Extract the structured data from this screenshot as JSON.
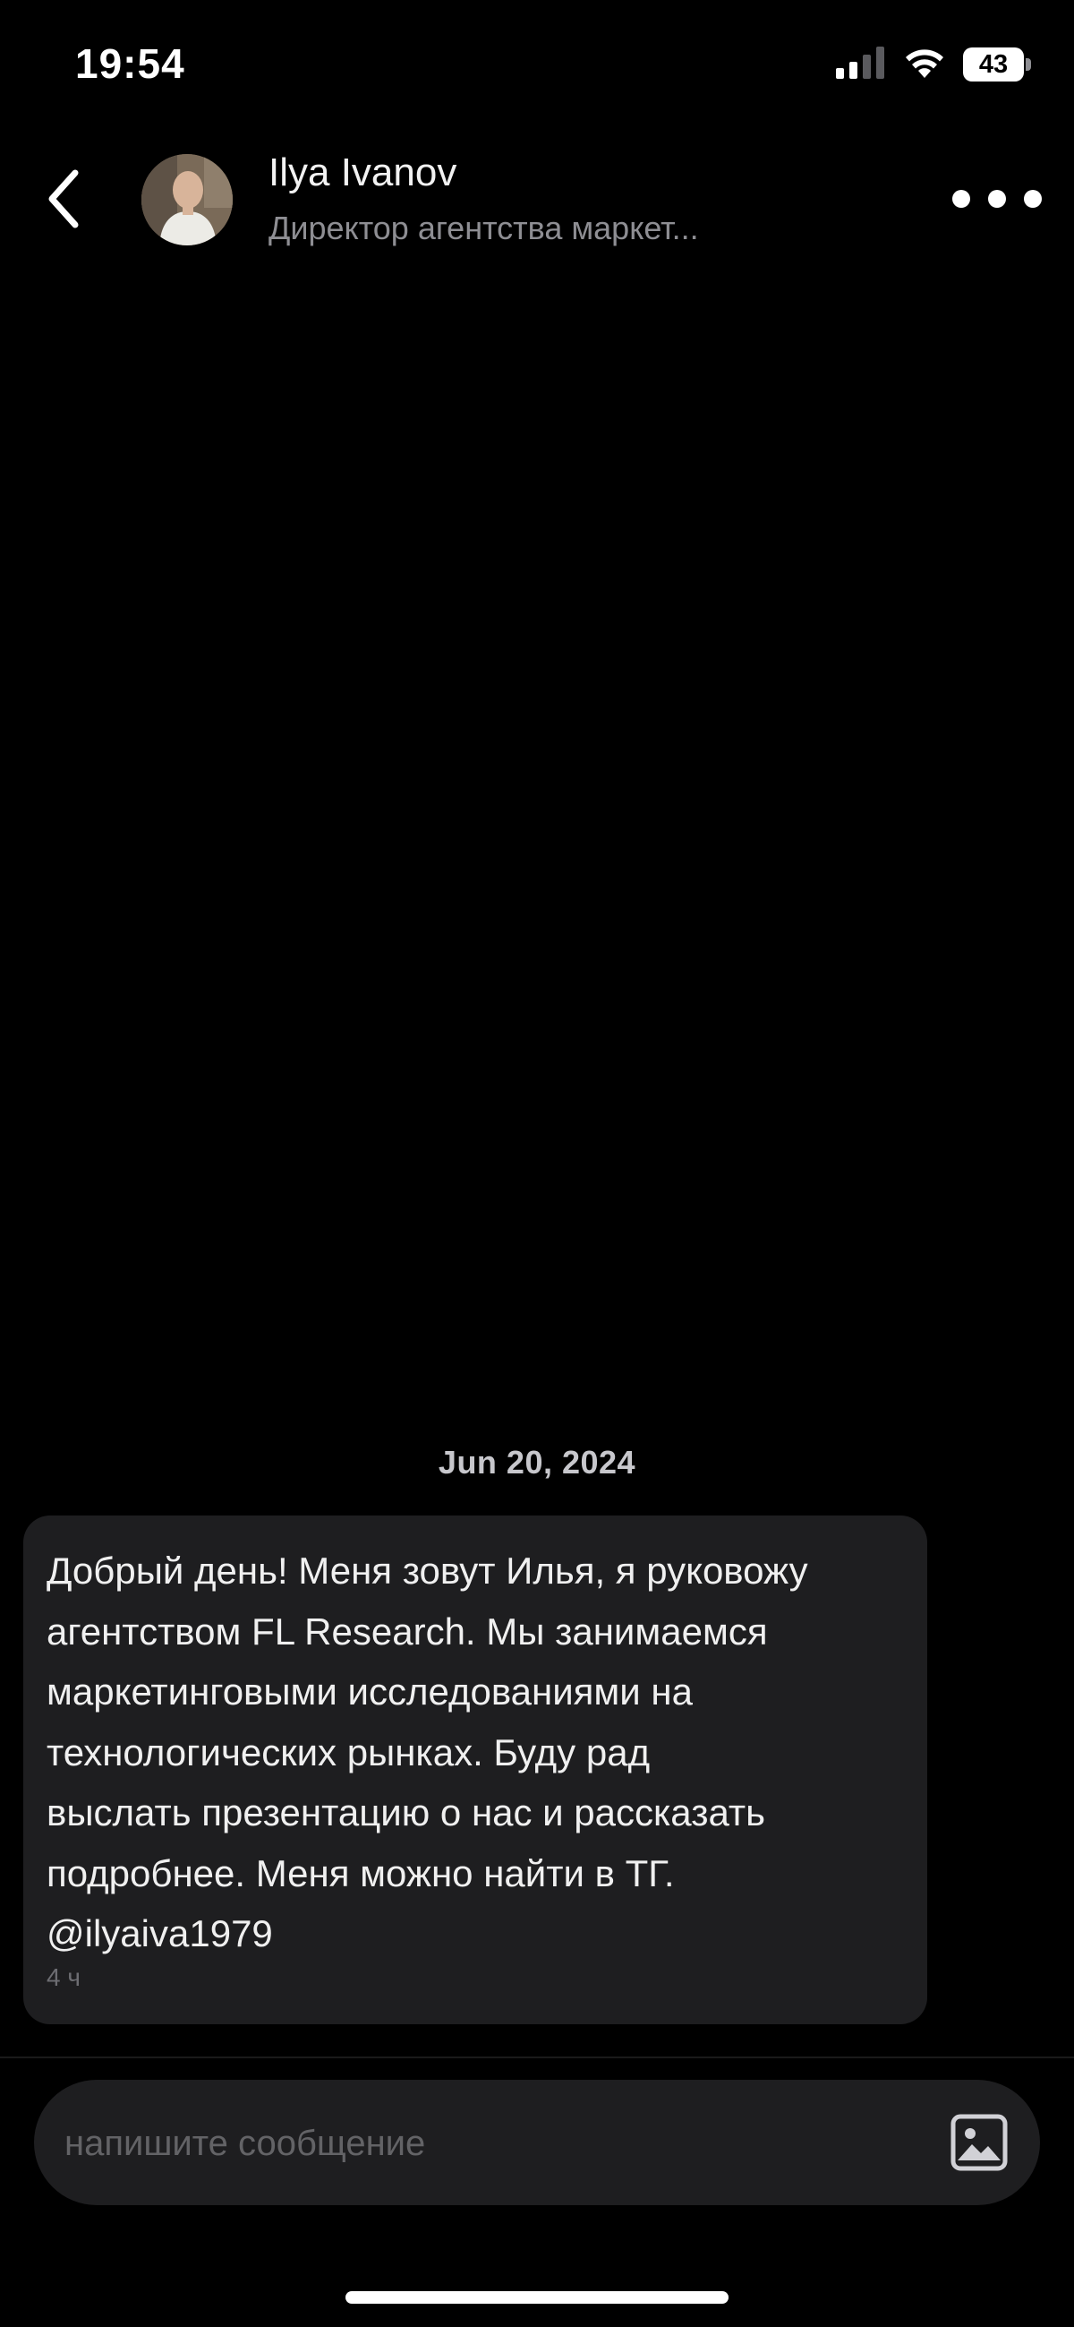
{
  "status_bar": {
    "time": "19:54",
    "battery_level": "43",
    "icons": [
      "cellular-signal-icon",
      "wifi-icon",
      "battery-icon"
    ]
  },
  "header": {
    "back_icon": "chevron-left-icon",
    "contact_name": "Ilya Ivanov",
    "contact_subtitle": "Директор агентства маркет...",
    "more_icon": "ellipsis-icon"
  },
  "conversation": {
    "date_separator": "Jun 20, 2024",
    "messages": [
      {
        "text": "Добрый день! Меня зовут Илья, я руковожу\nагентством FL Research. Мы занимаемся\nмаркетинговыми исследованиями на\nтехнологических рынках. Буду рад\nвыслать презентацию о нас и рассказать\nподробнее. Меня можно найти в ТГ.\n@ilyaiva1979",
        "time": "4 ч"
      }
    ]
  },
  "composer": {
    "placeholder": "напишите сообщение",
    "value": "",
    "attach_icon": "image-icon"
  },
  "colors": {
    "background": "#000000",
    "bubble": "#1e1e20",
    "secondary_text": "#8e8e93"
  }
}
